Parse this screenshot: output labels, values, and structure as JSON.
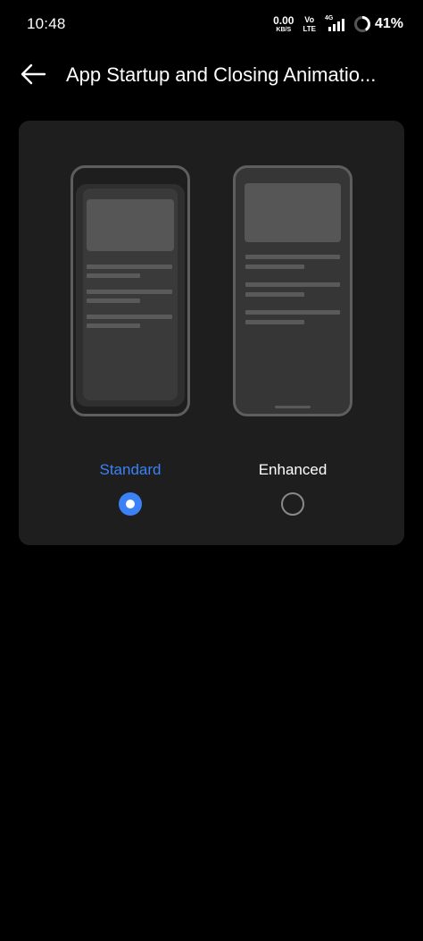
{
  "status_bar": {
    "time": "10:48",
    "net_speed_value": "0.00",
    "net_speed_unit": "KB/S",
    "volte_top": "Vo",
    "volte_bottom": "LTE",
    "network_type": "4G",
    "battery_percent": "41%",
    "battery_level": 0.41
  },
  "app_bar": {
    "back_icon": "arrow-left-icon",
    "title": "App Startup and Closing Animatio..."
  },
  "options": [
    {
      "label": "Standard",
      "selected": true,
      "label_color": "#3b82f6"
    },
    {
      "label": "Enhanced",
      "selected": false,
      "label_color": "#ffffff"
    }
  ],
  "colors": {
    "background": "#000000",
    "card": "#1e1e1e",
    "accent": "#3b82f6"
  }
}
